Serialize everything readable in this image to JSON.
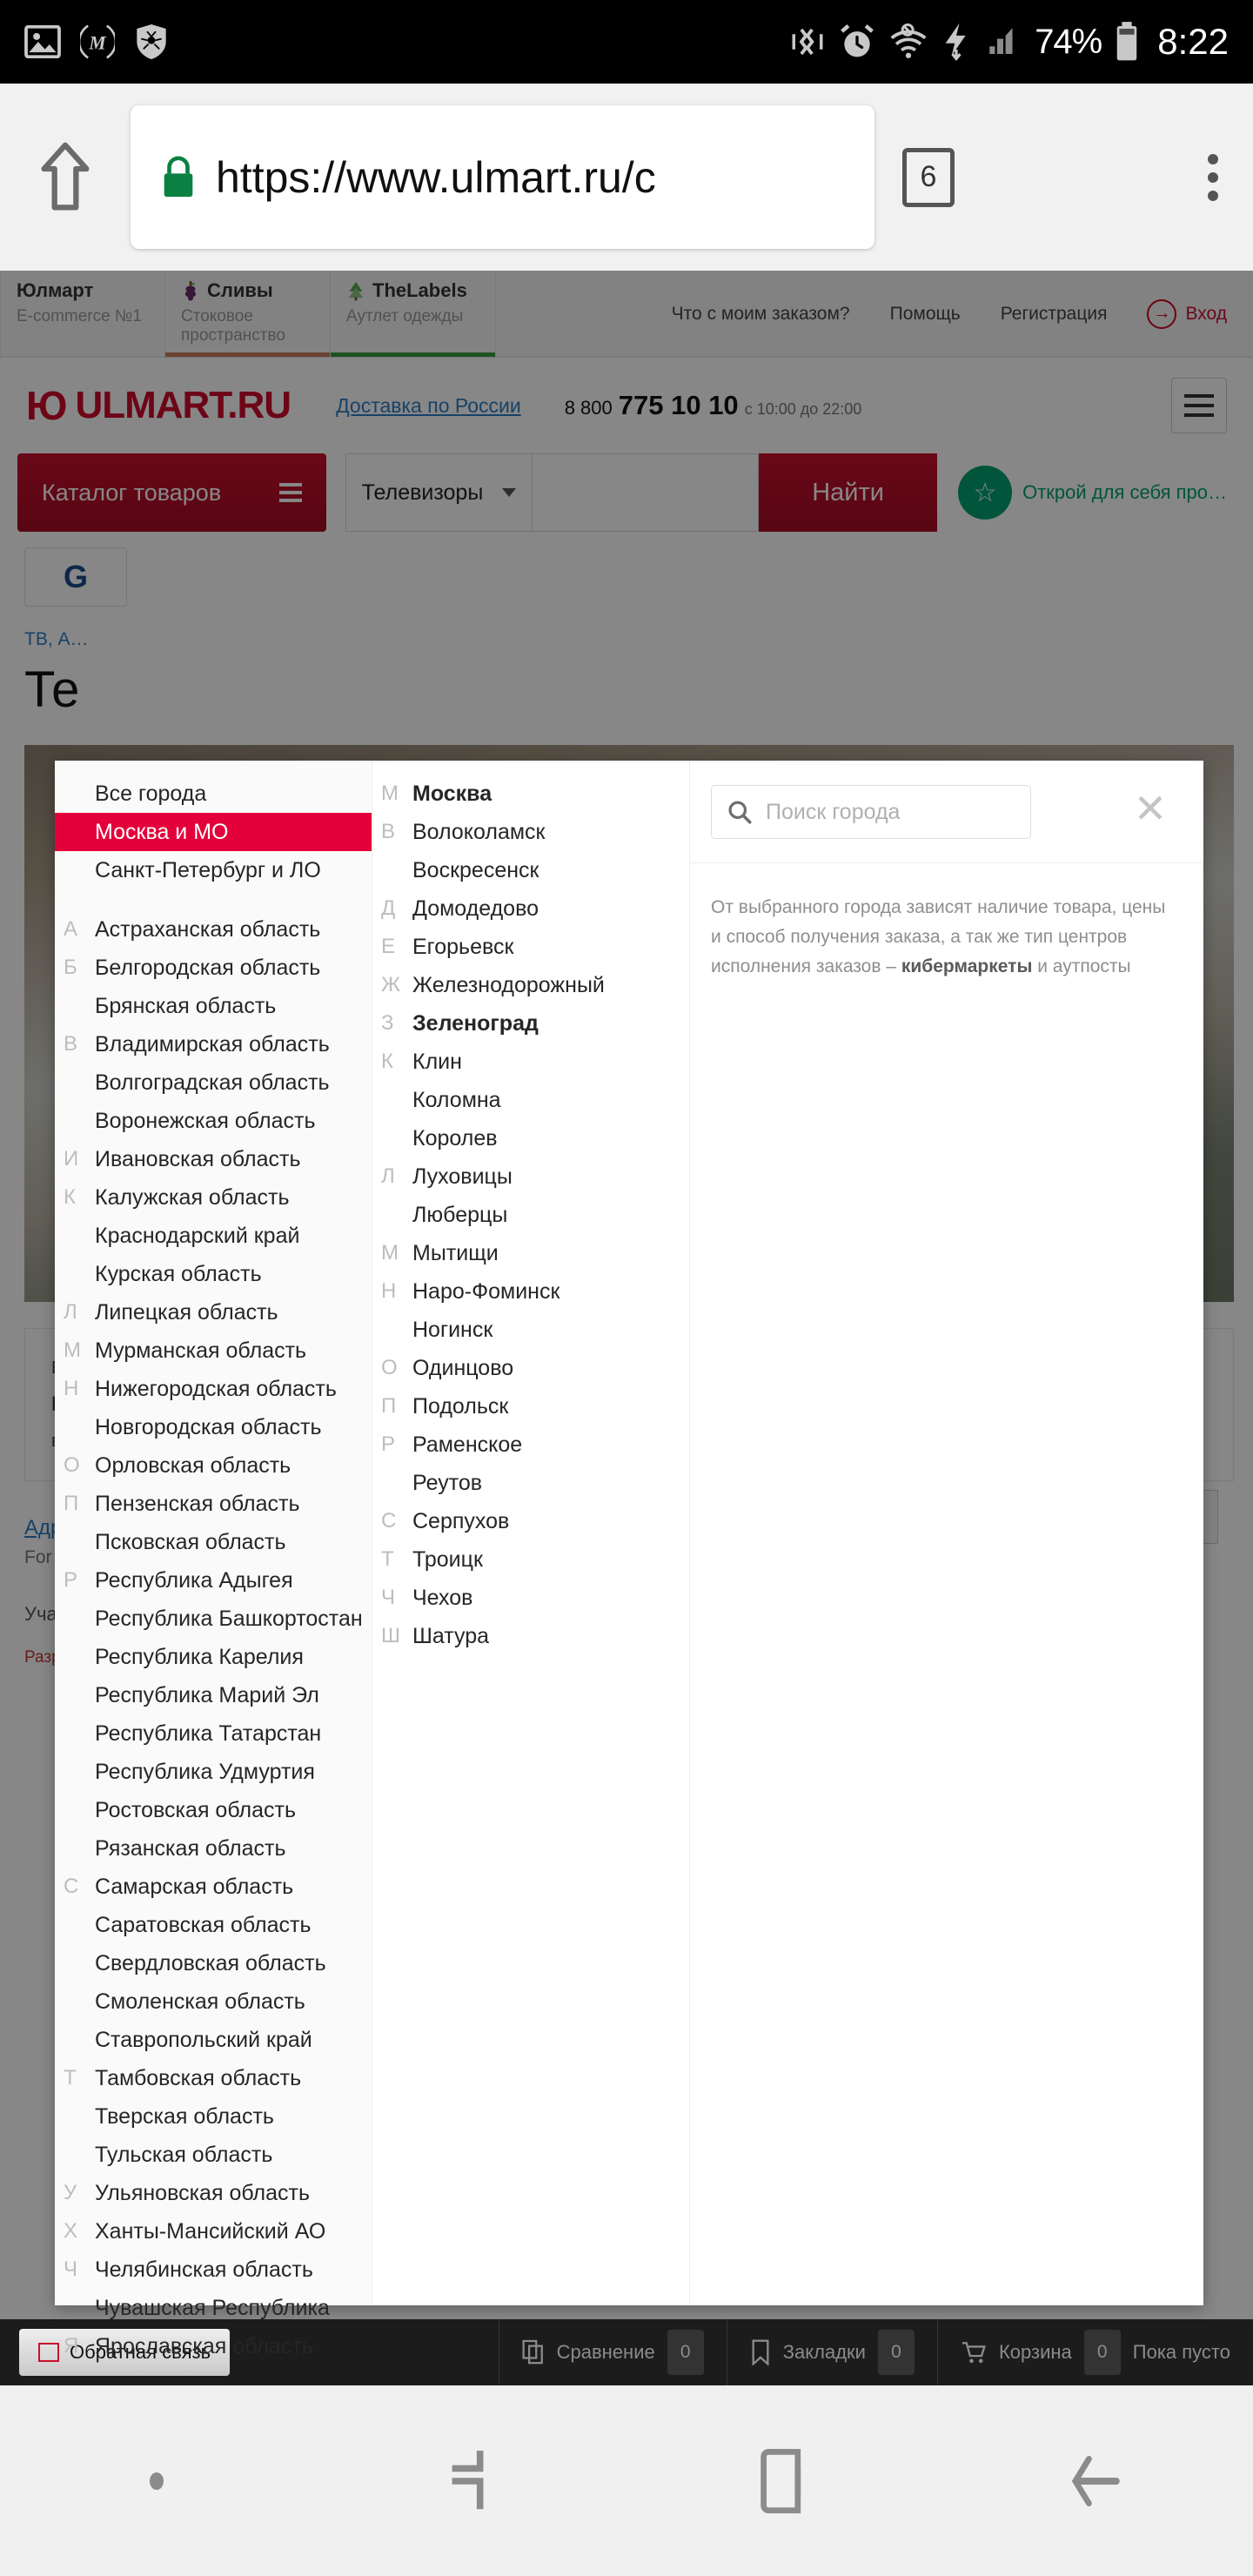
{
  "status_bar": {
    "battery_percent": "74%",
    "time": "8:22",
    "left_icons": [
      "image-icon",
      "m-logo-icon",
      "spider-shield-icon"
    ],
    "right_icons": [
      "vibrate-icon",
      "alarm-icon",
      "wifi-off-icon",
      "charging-bolt-icon",
      "signal-icon",
      "battery-icon"
    ]
  },
  "browser": {
    "url": "https://www.ulmart.ru/c",
    "tab_count": "6",
    "secure": true
  },
  "site_tabs": [
    {
      "title": "Юлмарт",
      "subtitle": "E-commerce №1",
      "marker": ""
    },
    {
      "title": "Сливы",
      "subtitle": "Стоковое пространство",
      "marker": "red"
    },
    {
      "title": "TheLabels",
      "subtitle": "Аутлет одежды",
      "marker": "green"
    }
  ],
  "top_links": [
    "Что с моим заказом?",
    "Помощь",
    "Регистрация"
  ],
  "login_label": "Вход",
  "header": {
    "logo": "ULMART.RU",
    "logo_mark": "Ю",
    "delivery": "Доставка по России",
    "phone_prefix": "8 800",
    "phone": "775 10 10",
    "hours": "с 10:00 до 22:00"
  },
  "search_row": {
    "catalog_label": "Каталог товаров",
    "category": "Телевизоры",
    "query": "",
    "find_label": "Найти",
    "promo_text": "Открой для себя про…"
  },
  "page_body": {
    "chip": "G",
    "breadcrumb": "ТВ, А…",
    "title": "Те",
    "footer_addr": "Адр",
    "footer_info": "For i",
    "footer_part": "Уча",
    "footer_dev": "Разработка — Digital Zone, поставщик ERP — Ultima"
  },
  "modal": {
    "regions": [
      {
        "letter": "",
        "name": "Все города",
        "selected": false
      },
      {
        "letter": "",
        "name": "Москва и МО",
        "selected": true
      },
      {
        "letter": "",
        "name": "Санкт-Петербург и ЛО",
        "selected": false
      },
      {
        "spacer": true
      },
      {
        "letter": "А",
        "name": "Астраханская область",
        "selected": false
      },
      {
        "letter": "Б",
        "name": "Белгородская область",
        "selected": false
      },
      {
        "letter": "",
        "name": "Брянская область",
        "selected": false
      },
      {
        "letter": "В",
        "name": "Владимирская область",
        "selected": false
      },
      {
        "letter": "",
        "name": "Волгоградская область",
        "selected": false
      },
      {
        "letter": "",
        "name": "Воронежская область",
        "selected": false
      },
      {
        "letter": "И",
        "name": "Ивановская область",
        "selected": false
      },
      {
        "letter": "К",
        "name": "Калужская область",
        "selected": false
      },
      {
        "letter": "",
        "name": "Краснодарский край",
        "selected": false
      },
      {
        "letter": "",
        "name": "Курская область",
        "selected": false
      },
      {
        "letter": "Л",
        "name": "Липецкая область",
        "selected": false
      },
      {
        "letter": "М",
        "name": "Мурманская область",
        "selected": false
      },
      {
        "letter": "Н",
        "name": "Нижегородская область",
        "selected": false
      },
      {
        "letter": "",
        "name": "Новгородская область",
        "selected": false
      },
      {
        "letter": "О",
        "name": "Орловская область",
        "selected": false
      },
      {
        "letter": "П",
        "name": "Пензенская область",
        "selected": false
      },
      {
        "letter": "",
        "name": "Псковская область",
        "selected": false
      },
      {
        "letter": "Р",
        "name": "Республика Адыгея",
        "selected": false
      },
      {
        "letter": "",
        "name": "Республика Башкортостан",
        "selected": false
      },
      {
        "letter": "",
        "name": "Республика Карелия",
        "selected": false
      },
      {
        "letter": "",
        "name": "Республика Марий Эл",
        "selected": false
      },
      {
        "letter": "",
        "name": "Республика Татарстан",
        "selected": false
      },
      {
        "letter": "",
        "name": "Республика Удмуртия",
        "selected": false
      },
      {
        "letter": "",
        "name": "Ростовская область",
        "selected": false
      },
      {
        "letter": "",
        "name": "Рязанская область",
        "selected": false
      },
      {
        "letter": "С",
        "name": "Самарская область",
        "selected": false
      },
      {
        "letter": "",
        "name": "Саратовская область",
        "selected": false
      },
      {
        "letter": "",
        "name": "Свердловская область",
        "selected": false
      },
      {
        "letter": "",
        "name": "Смоленская область",
        "selected": false
      },
      {
        "letter": "",
        "name": "Ставропольский край",
        "selected": false
      },
      {
        "letter": "Т",
        "name": "Тамбовская область",
        "selected": false
      },
      {
        "letter": "",
        "name": "Тверская область",
        "selected": false
      },
      {
        "letter": "",
        "name": "Тульская область",
        "selected": false
      },
      {
        "letter": "У",
        "name": "Ульяновская область",
        "selected": false
      },
      {
        "letter": "Х",
        "name": "Ханты-Мансийский АО",
        "selected": false
      },
      {
        "letter": "Ч",
        "name": "Челябинская область",
        "selected": false
      },
      {
        "letter": "",
        "name": "Чувашская Республика",
        "selected": false
      },
      {
        "letter": "Я",
        "name": "Ярославская область",
        "selected": false
      }
    ],
    "cities": [
      {
        "letter": "М",
        "name": "Москва",
        "bold": true
      },
      {
        "letter": "В",
        "name": "Волоколамск",
        "bold": false
      },
      {
        "letter": "",
        "name": "Воскресенск",
        "bold": false
      },
      {
        "letter": "Д",
        "name": "Домодедово",
        "bold": false
      },
      {
        "letter": "Е",
        "name": "Егорьевск",
        "bold": false
      },
      {
        "letter": "Ж",
        "name": "Железнодорожный",
        "bold": false
      },
      {
        "letter": "З",
        "name": "Зеленоград",
        "bold": true
      },
      {
        "letter": "К",
        "name": "Клин",
        "bold": false
      },
      {
        "letter": "",
        "name": "Коломна",
        "bold": false
      },
      {
        "letter": "",
        "name": "Королев",
        "bold": false
      },
      {
        "letter": "Л",
        "name": "Луховицы",
        "bold": false
      },
      {
        "letter": "",
        "name": "Люберцы",
        "bold": false
      },
      {
        "letter": "М",
        "name": "Мытищи",
        "bold": false
      },
      {
        "letter": "Н",
        "name": "Наро-Фоминск",
        "bold": false
      },
      {
        "letter": "",
        "name": "Ногинск",
        "bold": false
      },
      {
        "letter": "О",
        "name": "Одинцово",
        "bold": false
      },
      {
        "letter": "П",
        "name": "Подольск",
        "bold": false
      },
      {
        "letter": "Р",
        "name": "Раменское",
        "bold": false
      },
      {
        "letter": "",
        "name": "Реутов",
        "bold": false
      },
      {
        "letter": "С",
        "name": "Серпухов",
        "bold": false
      },
      {
        "letter": "Т",
        "name": "Троицк",
        "bold": false
      },
      {
        "letter": "Ч",
        "name": "Чехов",
        "bold": false
      },
      {
        "letter": "Ш",
        "name": "Шатура",
        "bold": false
      }
    ],
    "search_placeholder": "Поиск города",
    "search_value": "",
    "hint_part1": "От выбранного города зависят наличие товара, цены и способ получения заказа, а так же тип центров исполнения заказов – ",
    "hint_bold": "кибермаркеты",
    "hint_part2": " и аутпосты"
  },
  "page_footer": {
    "feedback": "Обратная связь",
    "compare_label": "Сравнение",
    "compare_count": "0",
    "bookmarks_label": "Закладки",
    "bookmarks_count": "0",
    "cart_label": "Корзина",
    "cart_count": "0",
    "cart_status": "Пока пусто"
  },
  "nav_bar": {
    "items": [
      "dot-icon",
      "recents-icon",
      "home-icon",
      "back-icon"
    ]
  },
  "colors": {
    "brand_red": "#c8102e",
    "selected_red": "#e4003a",
    "link_blue": "#2d7dc4",
    "green": "#00a070"
  }
}
